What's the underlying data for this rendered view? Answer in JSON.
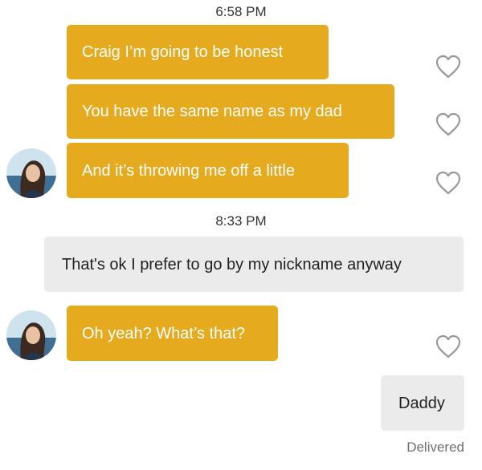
{
  "thread": {
    "time_1": "6:58 PM",
    "time_2": "8:33 PM",
    "messages": [
      {
        "text": "Craig I’m going to be honest",
        "direction": "incoming"
      },
      {
        "text": "You have the same name as my dad",
        "direction": "incoming"
      },
      {
        "text": "And it’s throwing me off a little",
        "direction": "incoming"
      },
      {
        "text": "That's ok I prefer to go by my nickname anyway",
        "direction": "outgoing"
      },
      {
        "text": "Oh yeah? What’s that?",
        "direction": "incoming"
      },
      {
        "text": "Daddy",
        "direction": "outgoing"
      }
    ],
    "status": "Delivered"
  },
  "colors": {
    "incoming_bubble": "#e6aa1e",
    "outgoing_bubble": "#ebebeb",
    "heart_outline": "#999999"
  },
  "icons": {
    "like": "heart-outline-icon",
    "avatar": "profile-photo"
  }
}
